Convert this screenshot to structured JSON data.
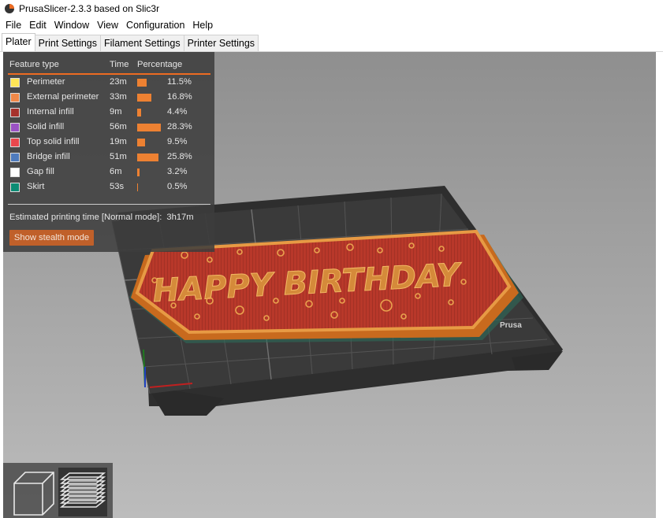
{
  "window": {
    "title": "PrusaSlicer-2.3.3 based on Slic3r"
  },
  "menu": [
    "File",
    "Edit",
    "Window",
    "View",
    "Configuration",
    "Help"
  ],
  "tabs": [
    "Plater",
    "Print Settings",
    "Filament Settings",
    "Printer Settings"
  ],
  "legend": {
    "headers": {
      "feature": "Feature type",
      "time": "Time",
      "percentage": "Percentage"
    },
    "rows": [
      {
        "name": "Perimeter",
        "time": "23m",
        "percent": "11.5%",
        "fraction": 0.115,
        "color": "#ffe556"
      },
      {
        "name": "External perimeter",
        "time": "33m",
        "percent": "16.8%",
        "fraction": 0.168,
        "color": "#f08848"
      },
      {
        "name": "Internal infill",
        "time": "9m",
        "percent": "4.4%",
        "fraction": 0.044,
        "color": "#a6322c"
      },
      {
        "name": "Solid infill",
        "time": "56m",
        "percent": "28.3%",
        "fraction": 0.283,
        "color": "#9a52c4"
      },
      {
        "name": "Top solid infill",
        "time": "19m",
        "percent": "9.5%",
        "fraction": 0.095,
        "color": "#e8474c"
      },
      {
        "name": "Bridge infill",
        "time": "51m",
        "percent": "25.8%",
        "fraction": 0.258,
        "color": "#4e7bbd"
      },
      {
        "name": "Gap fill",
        "time": "6m",
        "percent": "3.2%",
        "fraction": 0.032,
        "color": "#ffffff"
      },
      {
        "name": "Skirt",
        "time": "53s",
        "percent": "0.5%",
        "fraction": 0.005,
        "color": "#0c8c74"
      }
    ],
    "estimate_label": "Estimated printing time [Normal mode]:",
    "estimate_value": "3h17m",
    "stealth_button": "Show stealth mode"
  },
  "model": {
    "text": "HAPPY BIRTHDAY"
  },
  "bed": {
    "label": "Prusa"
  },
  "colors": {
    "accent": "#ed6b21",
    "legend_bg": "#3c3c3c"
  },
  "icons": {
    "view_3d": "cube-icon",
    "view_preview": "layers-icon"
  }
}
